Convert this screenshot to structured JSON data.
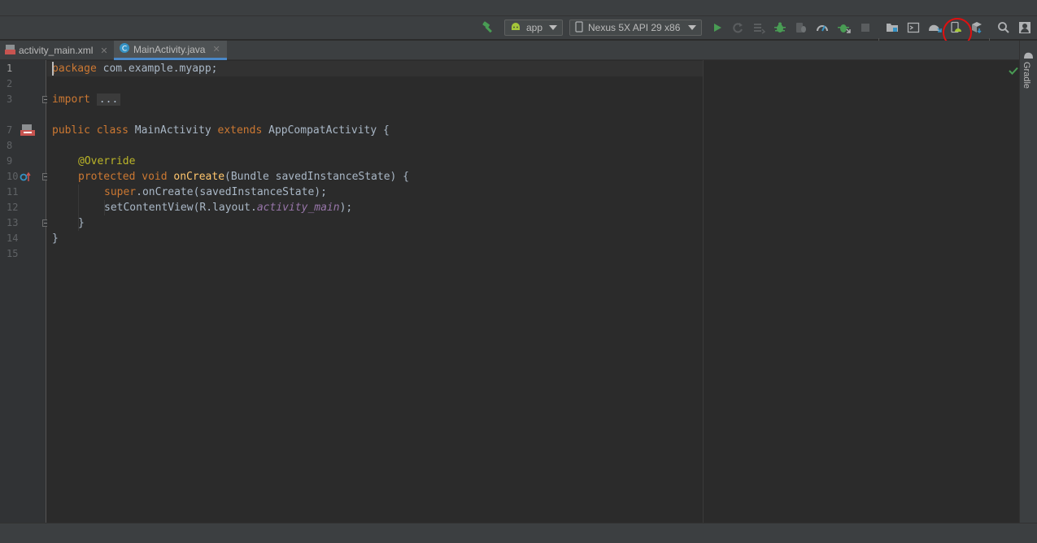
{
  "toolbar": {
    "module_select": {
      "label": "app",
      "icon": "android-icon"
    },
    "device_select": {
      "label": "Nexus 5X API 29 x86",
      "icon": "device-icon"
    },
    "icons": [
      "hammer-icon",
      "run-icon",
      "apply-changes-icon",
      "apply-code-changes-icon",
      "debug-icon",
      "attach-debugger-icon",
      "profile-icon",
      "coverage-icon",
      "stop-icon",
      "project-structure-icon",
      "terminal-icon",
      "gradle-sync-icon",
      "avd-manager-icon",
      "sdk-manager-icon",
      "search-icon",
      "account-icon"
    ],
    "accent_green": "#499c54"
  },
  "tabs": [
    {
      "label": "activity_main.xml",
      "icon": "xml-file-icon",
      "active": false
    },
    {
      "label": "MainActivity.java",
      "icon": "java-class-icon",
      "active": true
    }
  ],
  "gutter": {
    "line_numbers": [
      "1",
      "2",
      "3",
      "7",
      "8",
      "9",
      "10",
      "11",
      "12",
      "13",
      "14",
      "15"
    ]
  },
  "code": {
    "l1_kw": "package",
    "l1_rest": " com.example.myapp;",
    "l3_kw": "import",
    "l3_fold": "...",
    "l7_kw": "public class",
    "l7_name": " MainActivity ",
    "l7_kw2": "extends",
    "l7_rest": " AppCompatActivity {",
    "l9_ann": "@Override",
    "l10_kw": "protected void",
    "l10_fn": " onCreate",
    "l10_rest": "(Bundle savedInstanceState) {",
    "l11_kw": "super",
    "l11_rest": ".onCreate(savedInstanceState);",
    "l12_a": "setContentView(R.layout.",
    "l12_field": "activity_main",
    "l12_b": ");",
    "l13": "}",
    "l14": "}"
  },
  "right_strip": {
    "label": "Gradle"
  },
  "annotation_color": "#e01010"
}
